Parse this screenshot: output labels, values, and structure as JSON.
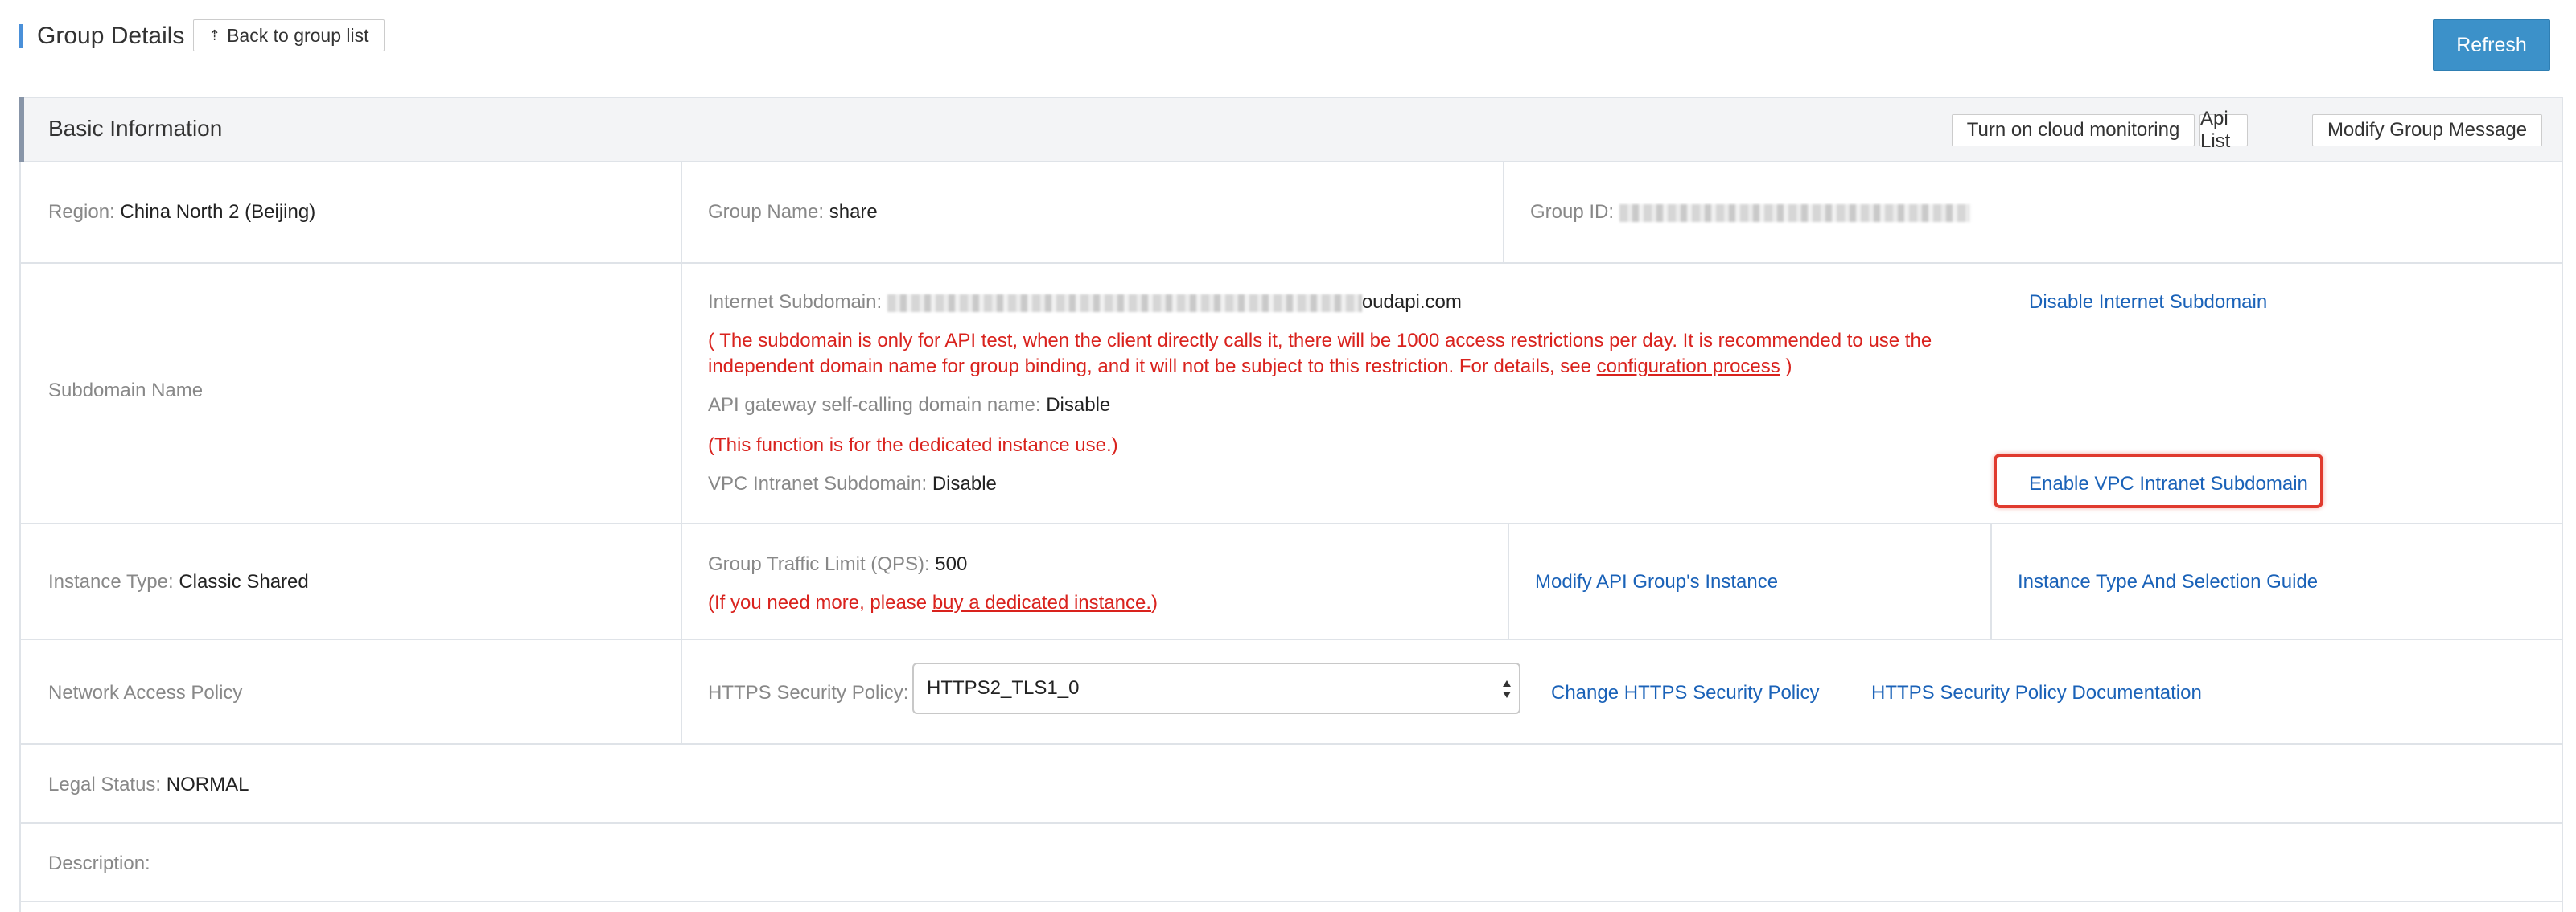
{
  "header": {
    "title": "Group Details",
    "back_label": "Back to group list",
    "refresh_label": "Refresh"
  },
  "panel": {
    "title": "Basic Information",
    "buttons": {
      "cloud_monitoring": "Turn on cloud monitoring",
      "api_list": "Api List",
      "modify_group": "Modify Group Message"
    }
  },
  "row1": {
    "region_label": "Region:",
    "region_value": "China North 2 (Beijing)",
    "group_name_label": "Group Name:",
    "group_name_value": "share",
    "group_id_label": "Group ID:"
  },
  "subdomain": {
    "section_label": "Subdomain Name",
    "internet_label": "Internet Subdomain:",
    "internet_value_suffix": "oudapi.com",
    "disable_internet_link": "Disable Internet Subdomain",
    "notice_line1": "( The subdomain is only for API test, when the client directly calls it, there will be 1000 access restrictions per day. It is recommended to use the",
    "notice_line2_prefix": "independent domain name for group binding, and it will not be subject to this restriction. For details, see ",
    "notice_link": "configuration process",
    "notice_line2_suffix": " )",
    "self_call_label": "API gateway self-calling domain name:",
    "self_call_value": "Disable",
    "dedicated_notice": "(This function is for the dedicated instance use.)",
    "vpc_label": "VPC Intranet Subdomain:",
    "vpc_value": "Disable",
    "enable_vpc_link": "Enable VPC Intranet Subdomain"
  },
  "instance": {
    "type_label": "Instance Type:",
    "type_value": "Classic Shared",
    "qps_label": "Group Traffic Limit (QPS):",
    "qps_value": "500",
    "more_prefix": "(If you need more, please ",
    "more_link": "buy a dedicated instance.",
    "more_suffix": ")",
    "modify_link": "Modify API Group's Instance",
    "guide_link": "Instance Type And Selection Guide"
  },
  "network": {
    "label": "Network Access Policy",
    "https_label": "HTTPS Security Policy:",
    "https_value": "HTTPS2_TLS1_0",
    "change_link": "Change HTTPS Security Policy",
    "doc_link": "HTTPS Security Policy Documentation"
  },
  "legal": {
    "label": "Legal Status:",
    "value": "NORMAL"
  },
  "description": {
    "label": "Description:"
  },
  "colors": {
    "accent": "#3c91c9",
    "link": "#1a62b8",
    "warning": "#d9221d",
    "highlight": "#e03a2e"
  }
}
